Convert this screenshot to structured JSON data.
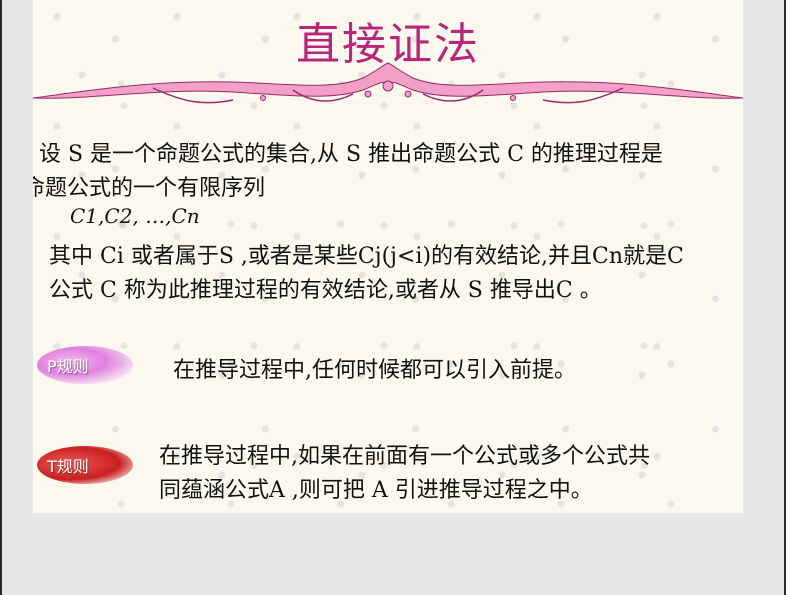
{
  "slide": {
    "title": "直接证法",
    "intro_line1": "设 S 是一个命题公式的集合,从 S 推出命题公式 C 的推理过程是",
    "intro_line2": "命题公式的一个有限序列",
    "sequence": "C1,C2, …,Cn",
    "detail_line1": "其中 Ci 或者属于S ,或者是某些Cj(j<i)的有效结论,并且Cn就是C",
    "detail_line2": "公式 C 称为此推理过程的有效结论,或者从 S 推导出C 。",
    "p_rule": {
      "label": "P规则",
      "text": "在推导过程中,任何时候都可以引入前提。"
    },
    "t_rule": {
      "label": "T规则",
      "text_line1": "在推导过程中,如果在前面有一个公式或多个公式共",
      "text_line2": "同蕴涵公式A ,则可把 A 引进推导过程之中。"
    }
  },
  "colors": {
    "title": "#b8257a",
    "ornament_fill": "#f3a0c8",
    "ornament_stroke": "#9a2a6a",
    "p_badge": "#e080e0",
    "t_badge": "#c81f1f",
    "background": "#fbf9ee",
    "frame": "#e6e6e6"
  }
}
